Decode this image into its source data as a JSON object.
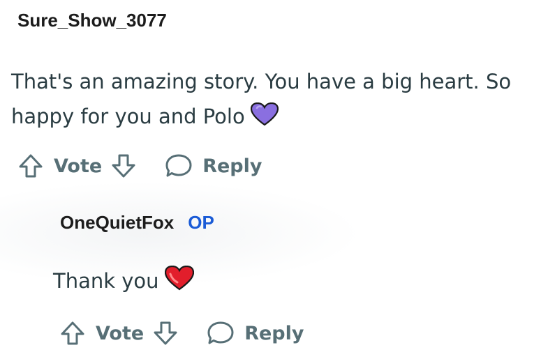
{
  "comment": {
    "username": "Sure_Show_3077",
    "body": "That's an amazing story. You have a big heart. So happy for you and Polo",
    "emoji": "purple-heart",
    "vote_label": "Vote",
    "reply_label": "Reply"
  },
  "reply": {
    "username": "OneQuietFox",
    "badge": "OP",
    "body": "Thank you",
    "emoji": "red-heart",
    "vote_label": "Vote",
    "reply_label": "Reply"
  },
  "colors": {
    "action_gray": "#576f76",
    "op_blue": "#1a5bd6",
    "purple_heart": "#8a6fe0",
    "red_heart": "#e21e2b"
  }
}
